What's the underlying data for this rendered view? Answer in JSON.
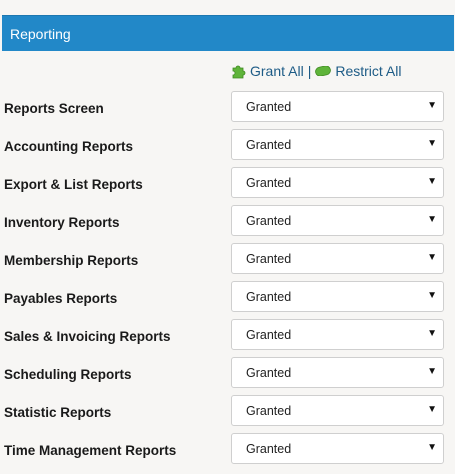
{
  "section": {
    "title": "Reporting"
  },
  "actions": {
    "grant_all": "Grant All",
    "separator": "|",
    "restrict_all": "Restrict All"
  },
  "colors": {
    "header_bg": "#2288c8",
    "link": "#1d5b86",
    "icon_green": "#5fb43a"
  },
  "permissions": [
    {
      "label": "Reports Screen",
      "value": "Granted"
    },
    {
      "label": "Accounting Reports",
      "value": "Granted"
    },
    {
      "label": "Export & List Reports",
      "value": "Granted"
    },
    {
      "label": "Inventory Reports",
      "value": "Granted"
    },
    {
      "label": "Membership Reports",
      "value": "Granted"
    },
    {
      "label": "Payables Reports",
      "value": "Granted"
    },
    {
      "label": "Sales & Invoicing Reports",
      "value": "Granted"
    },
    {
      "label": "Scheduling Reports",
      "value": "Granted"
    },
    {
      "label": "Statistic Reports",
      "value": "Granted"
    },
    {
      "label": "Time Management Reports",
      "value": "Granted"
    }
  ]
}
